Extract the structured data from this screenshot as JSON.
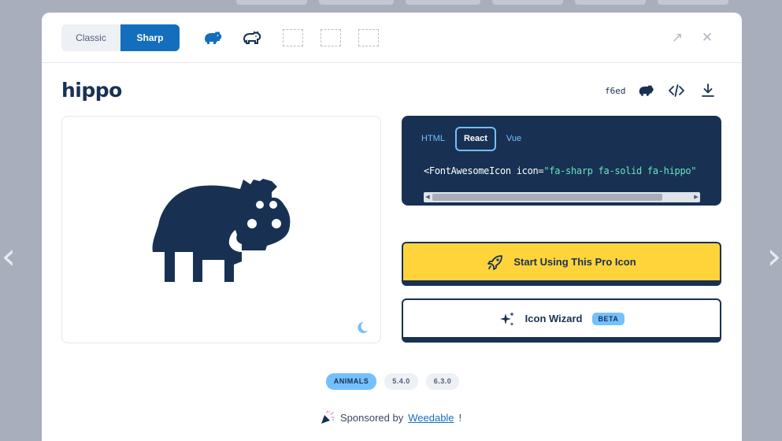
{
  "toolbar": {
    "style_options": [
      "Classic",
      "Sharp"
    ],
    "selected_style": "Sharp",
    "accent": "#146ebe"
  },
  "icon": {
    "name": "hippo",
    "unicode": "f6ed",
    "color": "#183153"
  },
  "code": {
    "tabs": [
      "HTML",
      "React",
      "Vue"
    ],
    "active_tab": "React",
    "snippet_prefix": "<FontAwesomeIcon icon=",
    "snippet_string": "\"fa-sharp fa-solid fa-hippo\""
  },
  "actions": {
    "primary_label": "Start Using This Pro Icon",
    "secondary_label": "Icon Wizard",
    "secondary_badge": "BETA",
    "primary_color": "#ffd43b"
  },
  "tags": {
    "category": "ANIMALS",
    "versions": [
      "5.4.0",
      "6.3.0"
    ]
  },
  "sponsor": {
    "prefix": "Sponsored by",
    "name": "Weedable",
    "suffix": "!"
  }
}
